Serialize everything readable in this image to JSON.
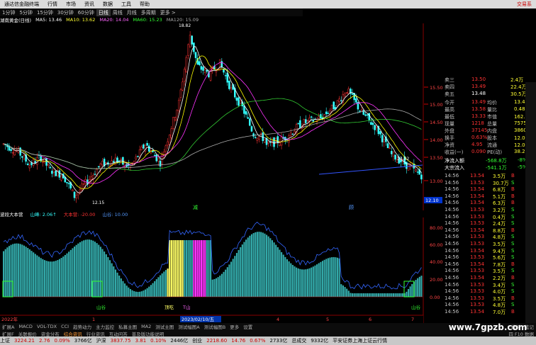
{
  "menu": {
    "title": "通达信金融终端",
    "items": [
      "行情",
      "市场",
      "资讯",
      "数据",
      "工具",
      "帮助"
    ],
    "right": "交易系"
  },
  "timeframes": [
    "1分钟",
    "5分钟",
    "15分钟",
    "30分钟",
    "60分钟",
    "日线",
    "周线",
    "月线",
    "多周期",
    "更多 >"
  ],
  "active_tf": "日线",
  "malegend": {
    "name": "湖南黄金(日线)",
    "ma5": "MA5: 13.46",
    "ma10": "MA10: 13.62",
    "ma20": "MA20: 14.04",
    "ma60": "MA60: 15.23",
    "ma120": "MA120: 15.09"
  },
  "colors": {
    "up": "#ff3333",
    "down": "#33ffff",
    "ma5": "#ffffff",
    "ma10": "#ffff00",
    "ma20": "#ff33ff",
    "ma60": "#33cc33",
    "ma120": "#aaaaaa"
  },
  "price_labels": [
    "18.82",
    "12.15",
    "13.02",
    "13.10",
    "12.10"
  ],
  "price_ticks": [
    "15.50",
    "15.00",
    "14.50",
    "14.00",
    "13.50",
    "13.00"
  ],
  "markers": [
    "减",
    "顾"
  ],
  "subchart": {
    "title": "波段大本营",
    "l1": "山峰: 2.06↑",
    "l2": "大本营: -20.00",
    "l3": "山谷: 10.00",
    "ticks": [
      "80.00",
      "60.00",
      "40.00",
      "20.00",
      "0.00"
    ],
    "bottom_labels": [
      "山谷",
      "顶吃",
      "T山",
      "山谷"
    ]
  },
  "dates": [
    "2022年",
    "1",
    "2023/02/10/五",
    "4",
    "5",
    "6",
    "7"
  ],
  "quote": {
    "ask3": [
      "卖三",
      "13.50",
      "2.4万"
    ],
    "ask2": [
      "卖四",
      "13.49",
      "22.4万"
    ],
    "ask1": [
      "卖五",
      "13.48",
      "30.5万"
    ],
    "rows": [
      [
        "今开",
        "13.49",
        "均价",
        "13.46"
      ],
      [
        "最高",
        "13.58",
        "量比",
        "0.48"
      ],
      [
        "最低",
        "13.33",
        "市值",
        "162.6亿"
      ],
      [
        "现量",
        "1218",
        "总量",
        "75752"
      ],
      [
        "外盘",
        "37145",
        "内盘",
        "38607"
      ],
      [
        "换手",
        "0.63%",
        "股本",
        "12.0亿"
      ],
      [
        "净资",
        "4.95",
        "流通",
        "12.0亿"
      ],
      [
        "收益(一)",
        "0.090",
        "PE(动)",
        "38.2"
      ]
    ],
    "flow": [
      [
        "净流入额",
        "-568.8万",
        "-8%"
      ],
      [
        "大宗流入",
        "-541.1万",
        "-5%"
      ]
    ],
    "ticks": [
      [
        "14:56",
        "13.54",
        "3.5万",
        "B",
        "5"
      ],
      [
        "14:56",
        "13.53",
        "30.7万",
        "S",
        "6"
      ],
      [
        "14:56",
        "13.54",
        "6.8万",
        "B",
        "5"
      ],
      [
        "14:56",
        "13.54",
        "5.1万",
        "B",
        "6"
      ],
      [
        "14:56",
        "13.54",
        "6.3万",
        "B",
        "9"
      ],
      [
        "14:56",
        "13.53",
        "3.2万",
        "S",
        "2"
      ],
      [
        "14:56",
        "13.53",
        "0.4万",
        "S",
        "0"
      ],
      [
        "14:56",
        "13.53",
        "2.4万",
        "S",
        "5"
      ],
      [
        "14:56",
        "13.54",
        "8.8万",
        "B",
        "5"
      ],
      [
        "14:56",
        "13.53",
        "4.8万",
        "S",
        "8"
      ],
      [
        "14:56",
        "13.53",
        "3.5万",
        "S",
        "5"
      ],
      [
        "14:56",
        "13.54",
        "9.4万",
        "S",
        "9"
      ],
      [
        "14:56",
        "13.53",
        "5.6万",
        "S",
        "8"
      ],
      [
        "14:56",
        "13.54",
        "7.8万",
        "B",
        "3"
      ],
      [
        "14:56",
        "13.53",
        "3.5万",
        "S",
        "9"
      ],
      [
        "14:56",
        "13.54",
        "2.2万",
        "B",
        "3"
      ],
      [
        "14:56",
        "13.53",
        "3.4万",
        "S",
        "5"
      ],
      [
        "14:56",
        "13.53",
        "4.0万",
        "S",
        "5"
      ],
      [
        "14:56",
        "13.53",
        "3.5万",
        "B",
        "5"
      ],
      [
        "14:56",
        "13.53",
        "4.8万",
        "S",
        "7"
      ],
      [
        "14:56",
        "13.54",
        "7.0万",
        "B",
        "4"
      ]
    ]
  },
  "tabs": [
    "扩展A",
    "MACD",
    "VOL-TDX",
    "CCI",
    "趋势动力",
    "主力监控",
    "私募主图",
    "MA2",
    "测试主图",
    "测试幅图A",
    "测试幅图B",
    "更多",
    "设置"
  ],
  "tabs2": [
    "扩展F",
    "关联报价",
    "资金分布",
    "综合资讯",
    "行业资讯",
    "互动问答",
    "普及版功能说明"
  ],
  "tabs2_right": "四 F10 数据",
  "side_tabs": [
    "模板",
    "笔记"
  ],
  "watermark": "www.7gpzb.com",
  "status": {
    "sh_name": "上证",
    "sh": "3224.21",
    "sh_chg": "2.76",
    "sh_pct": "0.09%",
    "sh_amt": "3766亿",
    "hs_name": "沪深",
    "hs": "3837.75",
    "hs_chg": "3.81",
    "hs_pct": "0.10%",
    "hs_amt": "2446亿",
    "cy_name": "创业",
    "cy": "2218.60",
    "cy_chg": "14.76",
    "cy_pct": "0.67%",
    "cy_amt": "2733亿",
    "total_name": "总成交",
    "total": "9332亿",
    "broker": "平安证券上海上证云行情"
  }
}
